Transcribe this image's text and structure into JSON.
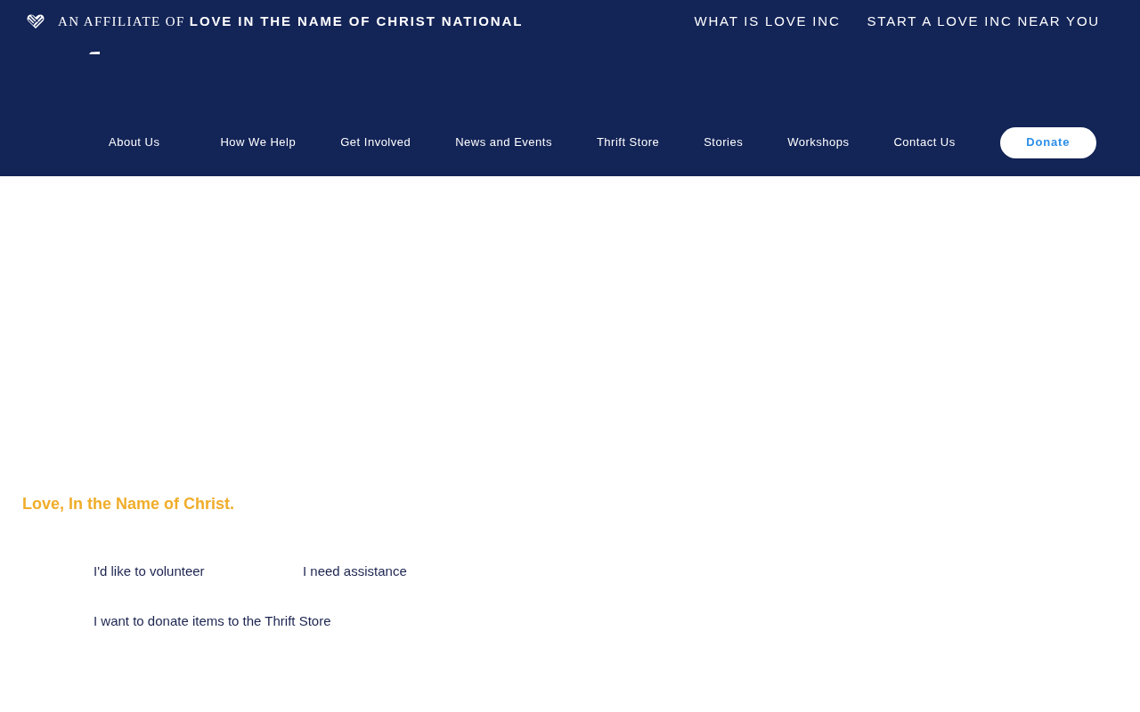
{
  "top_bar": {
    "affiliate_text": "AN AFFILIATE OF **LOVE IN THE NAME OF CHRIST NATIONAL**",
    "links": [
      "WHAT IS LOVE INC",
      "START A LOVE INC NEAR YOU"
    ]
  },
  "nav": {
    "items": [
      "About Us",
      "How We Help",
      "Get Involved",
      "News and Events",
      "Thrift Store",
      "Stories",
      "Workshops",
      "Contact Us"
    ],
    "donate_button": "Donate"
  },
  "hero": {
    "heading": "Love, In the Name of Christ.",
    "links": [
      "I'd like to volunteer",
      "I need assistance",
      "I want to donate items to the Thrift Store"
    ]
  }
}
